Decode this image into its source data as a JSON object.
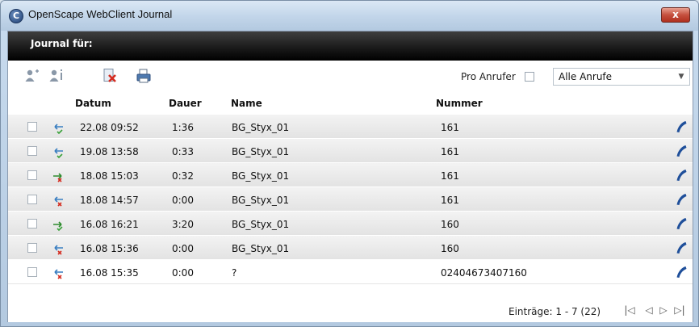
{
  "window": {
    "title": "OpenScape WebClient Journal",
    "close_label": "x"
  },
  "journal": {
    "header_label": "Journal für:"
  },
  "toolbar": {
    "pro_anrufer_label": "Pro Anrufer",
    "filter_selected": "Alle Anrufe"
  },
  "columns": {
    "datum": "Datum",
    "dauer": "Dauer",
    "name": "Name",
    "nummer": "Nummer"
  },
  "rows": [
    {
      "direction": "incoming-answered",
      "datum": "22.08 09:52",
      "dauer": "1:36",
      "name": "BG_Styx_01",
      "nummer": "161"
    },
    {
      "direction": "incoming-answered",
      "datum": "19.08 13:58",
      "dauer": "0:33",
      "name": "BG_Styx_01",
      "nummer": "161"
    },
    {
      "direction": "outgoing-missed",
      "datum": "18.08 15:03",
      "dauer": "0:32",
      "name": "BG_Styx_01",
      "nummer": "161"
    },
    {
      "direction": "incoming-missed",
      "datum": "18.08 14:57",
      "dauer": "0:00",
      "name": "BG_Styx_01",
      "nummer": "161"
    },
    {
      "direction": "outgoing-answered",
      "datum": "16.08 16:21",
      "dauer": "3:20",
      "name": "BG_Styx_01",
      "nummer": "160"
    },
    {
      "direction": "incoming-missed",
      "datum": "16.08 15:36",
      "dauer": "0:00",
      "name": "BG_Styx_01",
      "nummer": "160"
    },
    {
      "direction": "incoming-missed",
      "datum": "16.08 15:35",
      "dauer": "0:00",
      "name": "?",
      "nummer": "02404673407160"
    }
  ],
  "footer": {
    "entries_label": "Einträge: 1 - 7 (22)"
  },
  "colors": {
    "header_bg": "#000000",
    "answered_arrow": "#3a7fc1",
    "missed_mark": "#d42b1f",
    "outgoing_arrow": "#2e8b2e",
    "call_icon": "#1f4f9a"
  }
}
